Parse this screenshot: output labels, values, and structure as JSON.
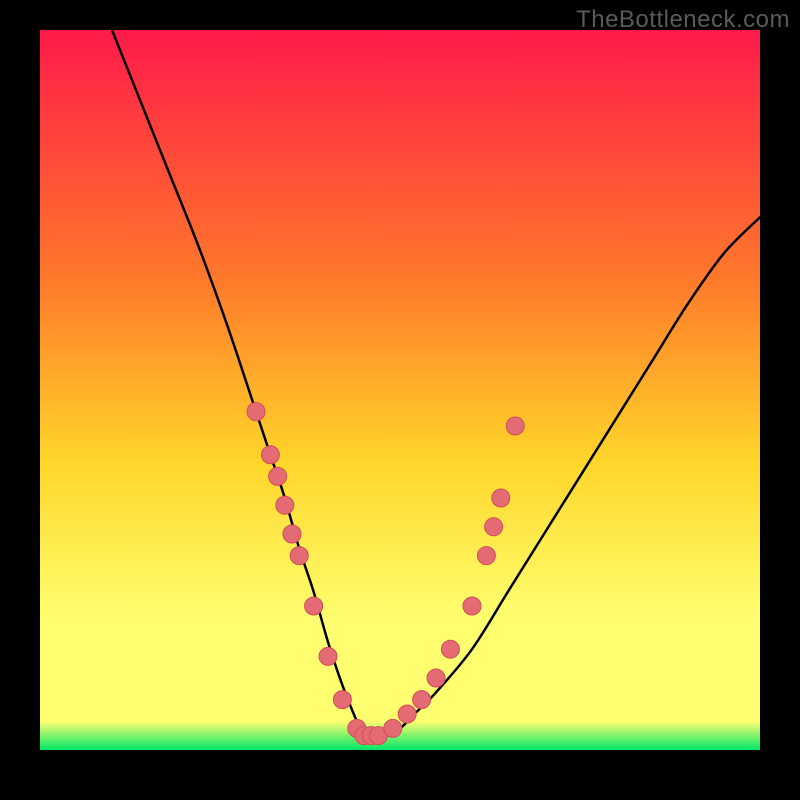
{
  "watermark": "TheBottleneck.com",
  "colors": {
    "frame": "#000000",
    "gradient_top": "#ff1a4a",
    "gradient_mid1": "#ff7a2a",
    "gradient_mid2": "#ffd62a",
    "gradient_mid3": "#ffff70",
    "gradient_bottom": "#00e867",
    "curve": "#000000",
    "marker_fill": "#e46a73",
    "marker_stroke": "#d24e58"
  },
  "chart_data": {
    "type": "line",
    "title": "",
    "xlabel": "",
    "ylabel": "",
    "xlim": [
      0,
      100
    ],
    "ylim": [
      0,
      100
    ],
    "notes": "V-shaped bottleneck curve; minimum (best match) around x≈45. Background vertical gradient: red (high bottleneck) at top → green (low bottleneck) at bottom. Pink markers cluster along both slopes near the valley floor.",
    "series": [
      {
        "name": "bottleneck-curve",
        "x": [
          10,
          14,
          18,
          22,
          26,
          30,
          32,
          34,
          36,
          38,
          40,
          42,
          44,
          45,
          46,
          48,
          50,
          52,
          55,
          60,
          65,
          70,
          75,
          80,
          85,
          90,
          95,
          100
        ],
        "y": [
          100,
          90,
          80,
          70,
          59,
          47,
          41,
          35,
          28,
          22,
          15,
          9,
          4,
          2,
          2,
          2,
          3,
          5,
          8,
          14,
          22,
          30,
          38,
          46,
          54,
          62,
          69,
          74
        ]
      }
    ],
    "markers": [
      {
        "x": 30,
        "y": 47
      },
      {
        "x": 32,
        "y": 41
      },
      {
        "x": 33,
        "y": 38
      },
      {
        "x": 34,
        "y": 34
      },
      {
        "x": 35,
        "y": 30
      },
      {
        "x": 36,
        "y": 27
      },
      {
        "x": 38,
        "y": 20
      },
      {
        "x": 40,
        "y": 13
      },
      {
        "x": 42,
        "y": 7
      },
      {
        "x": 44,
        "y": 3
      },
      {
        "x": 45,
        "y": 2
      },
      {
        "x": 46,
        "y": 2
      },
      {
        "x": 47,
        "y": 2
      },
      {
        "x": 49,
        "y": 3
      },
      {
        "x": 51,
        "y": 5
      },
      {
        "x": 53,
        "y": 7
      },
      {
        "x": 55,
        "y": 10
      },
      {
        "x": 57,
        "y": 14
      },
      {
        "x": 60,
        "y": 20
      },
      {
        "x": 62,
        "y": 27
      },
      {
        "x": 63,
        "y": 31
      },
      {
        "x": 64,
        "y": 35
      },
      {
        "x": 66,
        "y": 45
      }
    ]
  }
}
